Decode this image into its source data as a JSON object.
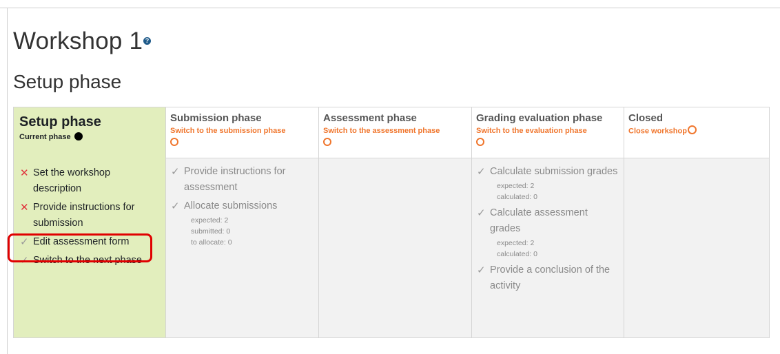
{
  "page": {
    "title": "Workshop 1",
    "help_icon_glyph": "?",
    "subtitle": "Setup phase"
  },
  "colors": {
    "accent_orange": "#f0762d",
    "active_phase_bg": "#e2eebd",
    "error_red": "#e0313a",
    "highlight_red": "#e00000"
  },
  "phases": [
    {
      "title": "Setup phase",
      "current_label": "Current phase",
      "tasks": [
        {
          "status": "x",
          "label": "Set the workshop description"
        },
        {
          "status": "x",
          "label": "Provide instructions for submission"
        },
        {
          "status": "check",
          "label": "Edit assessment form"
        },
        {
          "status": "check",
          "label": "Switch to the next phase"
        }
      ]
    },
    {
      "title": "Submission phase",
      "switch_label": "Switch to the submission phase",
      "tasks": [
        {
          "status": "check",
          "label": "Provide instructions for assessment"
        },
        {
          "status": "check",
          "label": "Allocate submissions",
          "details": [
            "expected: 2",
            "submitted: 0",
            "to allocate: 0"
          ]
        }
      ]
    },
    {
      "title": "Assessment phase",
      "switch_label": "Switch to the assessment phase",
      "tasks": []
    },
    {
      "title": "Grading evaluation phase",
      "switch_label": "Switch to the evaluation phase",
      "tasks": [
        {
          "status": "check",
          "label": "Calculate submission grades",
          "details": [
            "expected: 2",
            "calculated: 0"
          ]
        },
        {
          "status": "check",
          "label": "Calculate assessment grades",
          "details": [
            "expected: 2",
            "calculated: 0"
          ]
        },
        {
          "status": "check",
          "label": "Provide a conclusion of the activity"
        }
      ]
    },
    {
      "title": "Closed",
      "switch_label": "Close workshop",
      "tasks": []
    }
  ],
  "icons": {
    "x": "✕",
    "check": "✓"
  }
}
